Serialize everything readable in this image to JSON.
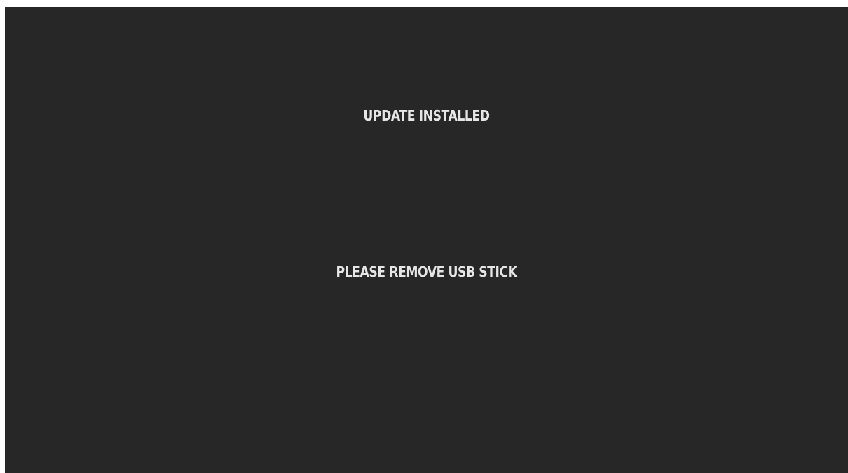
{
  "screen": {
    "title": "UPDATE INSTALLED",
    "instruction": "PLEASE REMOVE USB STICK",
    "background_color": "#272727",
    "text_color": "#e6e6e6"
  }
}
